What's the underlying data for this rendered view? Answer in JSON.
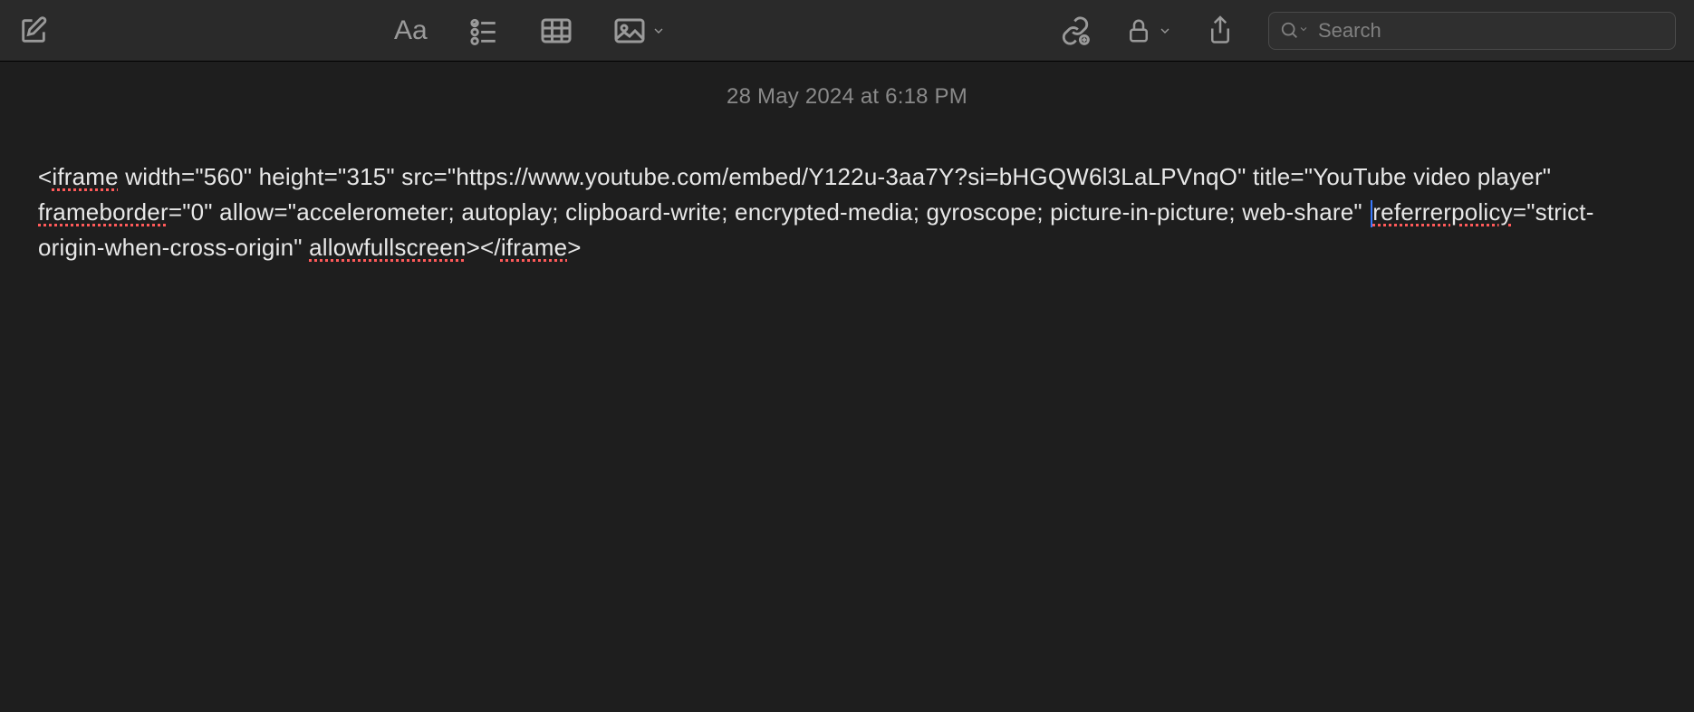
{
  "toolbar": {
    "format_label": "Aa",
    "search_placeholder": "Search"
  },
  "note": {
    "timestamp": "28 May 2024 at 6:18 PM",
    "body_parts": {
      "p1": "<",
      "p2": "iframe",
      "p3": " width=\"560\" height=\"315\" src=\"https://www.youtube.com/embed/Y122u-3aa7Y?si=bHGQW6l3LaLPVnqO\" title=\"YouTube video player\" ",
      "p4": "frameborder",
      "p5": "=\"0\" allow=\"accelerometer; autoplay; clipboard-write; encrypted-media; gyroscope; picture-in-picture; web-share\" ",
      "p6": "referrerpolicy",
      "p7": "=\"strict-origin-when-cross-origin\" ",
      "p8": "allowfullscreen",
      "p9": "></",
      "p10": "iframe",
      "p11": ">"
    }
  }
}
